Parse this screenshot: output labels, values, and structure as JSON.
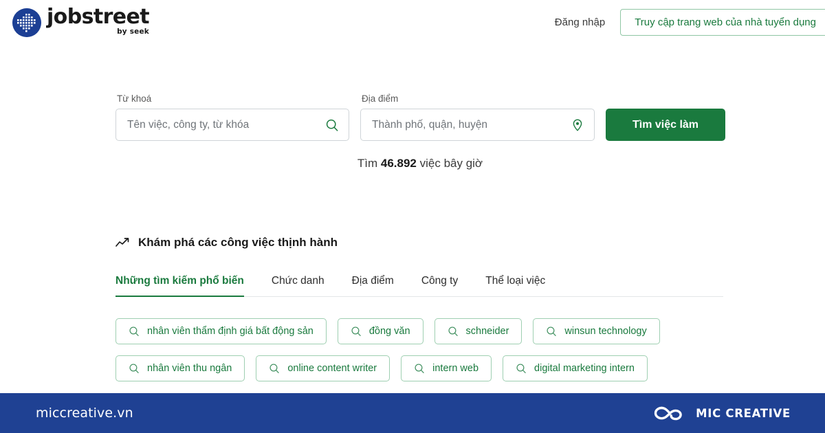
{
  "header": {
    "logo": {
      "mark_icon": "jobstreet-dot-logo-icon",
      "word": "jobstreet",
      "sub": "by seek",
      "mark_color": "#1c3f94"
    },
    "login_label": "Đăng nhập",
    "employer_button_label": "Truy cập trang web của nhà tuyển dụng"
  },
  "search": {
    "keyword": {
      "label": "Từ khoá",
      "placeholder": "Tên việc, công ty, từ khóa",
      "value": "",
      "icon": "search-icon"
    },
    "location": {
      "label": "Địa điểm",
      "placeholder": "Thành phố, quận, huyện",
      "value": "",
      "icon": "map-pin-icon"
    },
    "submit_label": "Tìm việc làm",
    "accent_color": "#1a7a3e"
  },
  "count": {
    "prefix": "Tìm ",
    "number": "46.892",
    "suffix": " việc bây giờ"
  },
  "trending": {
    "icon": "trending-up-icon",
    "title": "Khám phá các công việc thịnh hành",
    "tabs": [
      {
        "label": "Những tìm kiếm phổ biến",
        "active": true
      },
      {
        "label": "Chức danh",
        "active": false
      },
      {
        "label": "Địa điểm",
        "active": false
      },
      {
        "label": "Công ty",
        "active": false
      },
      {
        "label": "Thể loại việc",
        "active": false
      }
    ],
    "chips": [
      {
        "label": "nhân viên thẩm định giá bất động sản"
      },
      {
        "label": "đồng văn"
      },
      {
        "label": "schneider"
      },
      {
        "label": "winsun technology"
      },
      {
        "label": "nhân viên thu ngân"
      },
      {
        "label": "online content writer"
      },
      {
        "label": "intern web"
      },
      {
        "label": "digital marketing intern"
      }
    ]
  },
  "footer": {
    "url": "miccreative.vn",
    "logo_icon": "mic-infinity-logo-icon",
    "brand": "MIC CREATIVE",
    "background": "#1f4193"
  }
}
